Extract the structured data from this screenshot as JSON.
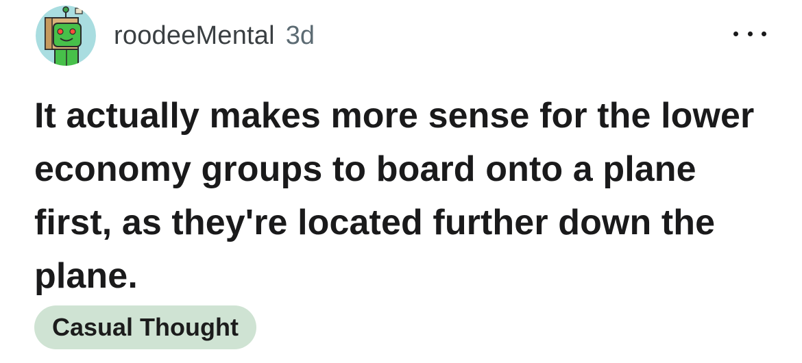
{
  "post": {
    "username": "roodeeMental",
    "age": "3d",
    "title": "It actually makes more sense for the lower economy groups to board onto a plane first, as they're located further down the plane.",
    "flair": "Casual Thought"
  },
  "icons": {
    "avatar": "robot-avatar-icon",
    "more": "more-options-icon"
  },
  "colors": {
    "flair_background": "#cfe3d3",
    "username_text": "#3a3f42",
    "age_text": "#5c6b73",
    "avatar_background": "#a9dde0"
  }
}
